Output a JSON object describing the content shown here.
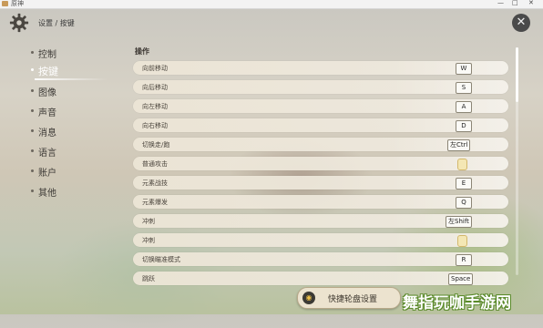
{
  "window": {
    "title": "原神",
    "controls": [
      "—",
      "□",
      "✕"
    ]
  },
  "header": {
    "gear_icon": "gear-icon",
    "breadcrumb": "设置 / 按键",
    "close_label": "✕"
  },
  "sidebar": {
    "items": [
      {
        "label": "控制",
        "active": false
      },
      {
        "label": "按键",
        "active": true
      },
      {
        "label": "图像",
        "active": false
      },
      {
        "label": "声音",
        "active": false
      },
      {
        "label": "消息",
        "active": false
      },
      {
        "label": "语言",
        "active": false
      },
      {
        "label": "账户",
        "active": false
      },
      {
        "label": "其他",
        "active": false
      }
    ]
  },
  "section": {
    "title": "操作"
  },
  "bindings": [
    {
      "action": "向前移动",
      "key": "W"
    },
    {
      "action": "向后移动",
      "key": "S"
    },
    {
      "action": "向左移动",
      "key": "A"
    },
    {
      "action": "向右移动",
      "key": "D"
    },
    {
      "action": "切换走/跑",
      "key": "左Ctrl"
    },
    {
      "action": "普通攻击",
      "key": "",
      "icon": "mouse-icon"
    },
    {
      "action": "元素战技",
      "key": "E"
    },
    {
      "action": "元素爆发",
      "key": "Q"
    },
    {
      "action": "冲刺",
      "key": "左Shift"
    },
    {
      "action": "冲刺",
      "key": "",
      "icon": "mouse-icon"
    },
    {
      "action": "切换瞄准模式",
      "key": "R"
    },
    {
      "action": "跳跃",
      "key": "Space"
    }
  ],
  "footer": {
    "wheel_button_label": "快捷轮盘设置"
  },
  "watermark": "舞指玩咖手游网",
  "colors": {
    "row_bg": "#ece5d6",
    "key_bg": "#fbfaf6",
    "active_nav": "#ffffff"
  }
}
